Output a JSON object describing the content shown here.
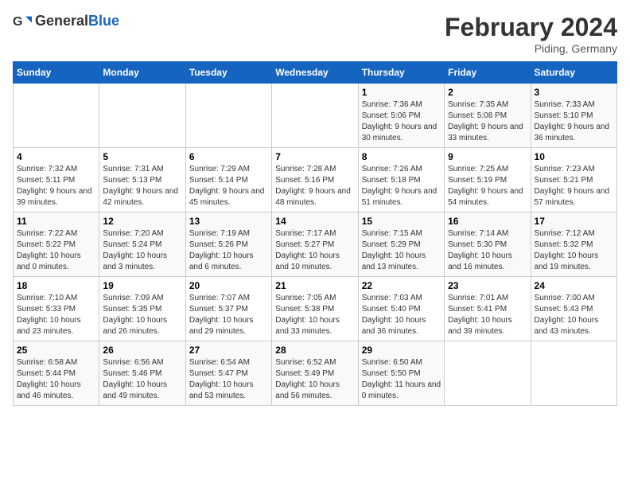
{
  "header": {
    "logo_general": "General",
    "logo_blue": "Blue",
    "month_title": "February 2024",
    "location": "Piding, Germany"
  },
  "days_of_week": [
    "Sunday",
    "Monday",
    "Tuesday",
    "Wednesday",
    "Thursday",
    "Friday",
    "Saturday"
  ],
  "weeks": [
    [
      {
        "day": "",
        "info": ""
      },
      {
        "day": "",
        "info": ""
      },
      {
        "day": "",
        "info": ""
      },
      {
        "day": "",
        "info": ""
      },
      {
        "day": "1",
        "info": "Sunrise: 7:36 AM\nSunset: 5:06 PM\nDaylight: 9 hours and 30 minutes."
      },
      {
        "day": "2",
        "info": "Sunrise: 7:35 AM\nSunset: 5:08 PM\nDaylight: 9 hours and 33 minutes."
      },
      {
        "day": "3",
        "info": "Sunrise: 7:33 AM\nSunset: 5:10 PM\nDaylight: 9 hours and 36 minutes."
      }
    ],
    [
      {
        "day": "4",
        "info": "Sunrise: 7:32 AM\nSunset: 5:11 PM\nDaylight: 9 hours and 39 minutes."
      },
      {
        "day": "5",
        "info": "Sunrise: 7:31 AM\nSunset: 5:13 PM\nDaylight: 9 hours and 42 minutes."
      },
      {
        "day": "6",
        "info": "Sunrise: 7:29 AM\nSunset: 5:14 PM\nDaylight: 9 hours and 45 minutes."
      },
      {
        "day": "7",
        "info": "Sunrise: 7:28 AM\nSunset: 5:16 PM\nDaylight: 9 hours and 48 minutes."
      },
      {
        "day": "8",
        "info": "Sunrise: 7:26 AM\nSunset: 5:18 PM\nDaylight: 9 hours and 51 minutes."
      },
      {
        "day": "9",
        "info": "Sunrise: 7:25 AM\nSunset: 5:19 PM\nDaylight: 9 hours and 54 minutes."
      },
      {
        "day": "10",
        "info": "Sunrise: 7:23 AM\nSunset: 5:21 PM\nDaylight: 9 hours and 57 minutes."
      }
    ],
    [
      {
        "day": "11",
        "info": "Sunrise: 7:22 AM\nSunset: 5:22 PM\nDaylight: 10 hours and 0 minutes."
      },
      {
        "day": "12",
        "info": "Sunrise: 7:20 AM\nSunset: 5:24 PM\nDaylight: 10 hours and 3 minutes."
      },
      {
        "day": "13",
        "info": "Sunrise: 7:19 AM\nSunset: 5:26 PM\nDaylight: 10 hours and 6 minutes."
      },
      {
        "day": "14",
        "info": "Sunrise: 7:17 AM\nSunset: 5:27 PM\nDaylight: 10 hours and 10 minutes."
      },
      {
        "day": "15",
        "info": "Sunrise: 7:15 AM\nSunset: 5:29 PM\nDaylight: 10 hours and 13 minutes."
      },
      {
        "day": "16",
        "info": "Sunrise: 7:14 AM\nSunset: 5:30 PM\nDaylight: 10 hours and 16 minutes."
      },
      {
        "day": "17",
        "info": "Sunrise: 7:12 AM\nSunset: 5:32 PM\nDaylight: 10 hours and 19 minutes."
      }
    ],
    [
      {
        "day": "18",
        "info": "Sunrise: 7:10 AM\nSunset: 5:33 PM\nDaylight: 10 hours and 23 minutes."
      },
      {
        "day": "19",
        "info": "Sunrise: 7:09 AM\nSunset: 5:35 PM\nDaylight: 10 hours and 26 minutes."
      },
      {
        "day": "20",
        "info": "Sunrise: 7:07 AM\nSunset: 5:37 PM\nDaylight: 10 hours and 29 minutes."
      },
      {
        "day": "21",
        "info": "Sunrise: 7:05 AM\nSunset: 5:38 PM\nDaylight: 10 hours and 33 minutes."
      },
      {
        "day": "22",
        "info": "Sunrise: 7:03 AM\nSunset: 5:40 PM\nDaylight: 10 hours and 36 minutes."
      },
      {
        "day": "23",
        "info": "Sunrise: 7:01 AM\nSunset: 5:41 PM\nDaylight: 10 hours and 39 minutes."
      },
      {
        "day": "24",
        "info": "Sunrise: 7:00 AM\nSunset: 5:43 PM\nDaylight: 10 hours and 43 minutes."
      }
    ],
    [
      {
        "day": "25",
        "info": "Sunrise: 6:58 AM\nSunset: 5:44 PM\nDaylight: 10 hours and 46 minutes."
      },
      {
        "day": "26",
        "info": "Sunrise: 6:56 AM\nSunset: 5:46 PM\nDaylight: 10 hours and 49 minutes."
      },
      {
        "day": "27",
        "info": "Sunrise: 6:54 AM\nSunset: 5:47 PM\nDaylight: 10 hours and 53 minutes."
      },
      {
        "day": "28",
        "info": "Sunrise: 6:52 AM\nSunset: 5:49 PM\nDaylight: 10 hours and 56 minutes."
      },
      {
        "day": "29",
        "info": "Sunrise: 6:50 AM\nSunset: 5:50 PM\nDaylight: 11 hours and 0 minutes."
      },
      {
        "day": "",
        "info": ""
      },
      {
        "day": "",
        "info": ""
      }
    ]
  ]
}
